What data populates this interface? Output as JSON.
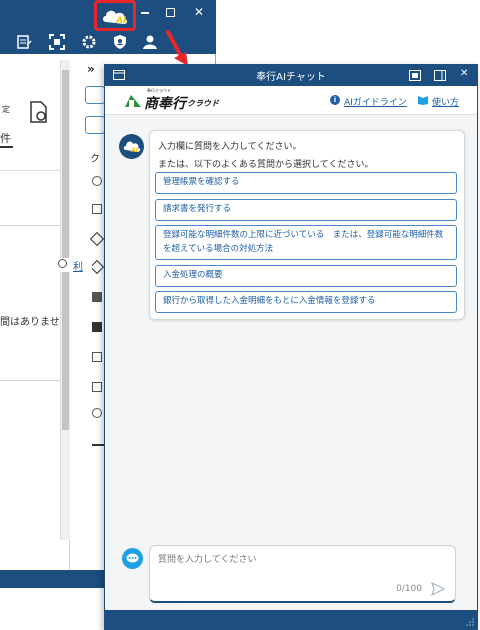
{
  "background_app": {
    "pane_texts": [
      "»",
      "定",
      "件",
      "ク",
      "利",
      "間はありませ"
    ],
    "colors": {
      "titlebar": "#1c4e80",
      "highlight": "#e8262b"
    }
  },
  "ai_button": {
    "label": "AI"
  },
  "chat": {
    "title": "奉行AIチャット",
    "logo_small": "奉行クラウド",
    "logo_main": "商奉行",
    "logo_suffix": "クラウド",
    "guide_link": "AIガイドライン",
    "howto_link": "使い方",
    "greeting": "入力欄に質問を入力してください。",
    "prompt": "または、以下のよくある質問から選択してください。",
    "faq": [
      "管理帳票を確認する",
      "請求書を発行する",
      "登録可能な明細件数の上限に近づいている　または、登録可能な明細件数を超えている場合の対処方法",
      "入金処理の概要",
      "銀行から取得した入金明細をもとに入金情報を登録する"
    ],
    "input_placeholder": "質問を入力してください",
    "counter": "0/100"
  }
}
